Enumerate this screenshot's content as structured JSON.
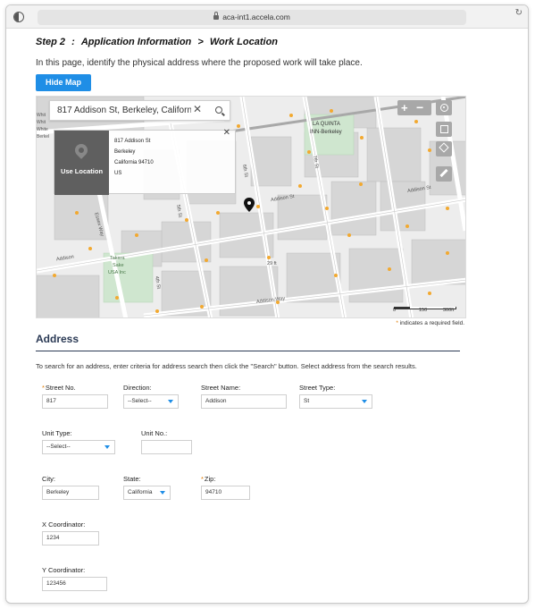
{
  "browser": {
    "url": "aca-int1.accela.com"
  },
  "page": {
    "step_label": "Step 2",
    "step_separator": ":",
    "breadcrumb_parent": "Application Information",
    "breadcrumb_arrow": ">",
    "breadcrumb_current": "Work Location",
    "instructions": "In this page, identify the physical address where the proposed work will take place.",
    "hide_map_label": "Hide Map"
  },
  "map": {
    "search_value": "817 Addison St, Berkeley, California",
    "popup": {
      "use_location_label": "Use Location",
      "address_lines": [
        "817 Addison St",
        "Berkeley",
        "California 94710",
        "US"
      ]
    },
    "place_labels": {
      "la_quinta": "LA QUINTA",
      "inn_berkeley": "INN-Berkeley",
      "takara_sake": "Takara",
      "takara_sake_2": "Sake",
      "takara_usa": "USA Inc",
      "street_addison": "Addison St",
      "street_addison_2": "Addison St",
      "street_addison_3": "Addison Way",
      "street_6th": "6th St",
      "street_5th": "5th St",
      "street_essex": "Essex Way",
      "street_29": "29 ft",
      "street_4th": "4th St",
      "street_7th": "7th St",
      "addison_west": "Addison",
      "white_house_1": "Whit",
      "white_house_2": "Whit",
      "white_house_3": "White",
      "white_house_4": "Berkel",
      "scale_0": "0",
      "scale_150": "150",
      "scale_300": "300ft"
    }
  },
  "required_note": {
    "asterisk": "*",
    "text": "indicates a required field."
  },
  "address_section": {
    "title": "Address",
    "hint": "To search for an address, enter criteria for address search then click the \"Search\" button. Select address from the search results.",
    "street_no": {
      "label": "Street No.",
      "value": "817",
      "required": "*"
    },
    "direction": {
      "label": "Direction:",
      "value": "--Select--"
    },
    "street_name": {
      "label": "Street Name:",
      "value": "Addison"
    },
    "street_type": {
      "label": "Street Type:",
      "value": "St"
    },
    "unit_type": {
      "label": "Unit Type:",
      "value": "--Select--"
    },
    "unit_no": {
      "label": "Unit No.:",
      "value": ""
    },
    "city": {
      "label": "City:",
      "value": "Berkeley"
    },
    "state": {
      "label": "State:",
      "value": "California"
    },
    "zip": {
      "label": "Zip:",
      "value": "94710",
      "required": "*"
    },
    "x_coord": {
      "label": "X Coordinator:",
      "value": "1234"
    },
    "y_coord": {
      "label": "Y Coordinator:",
      "value": "123456"
    }
  },
  "colors": {
    "accent": "#1f8ee6",
    "heading": "#2b3a55",
    "required": "#e07b00",
    "map_popup": "#5f5f5f"
  }
}
